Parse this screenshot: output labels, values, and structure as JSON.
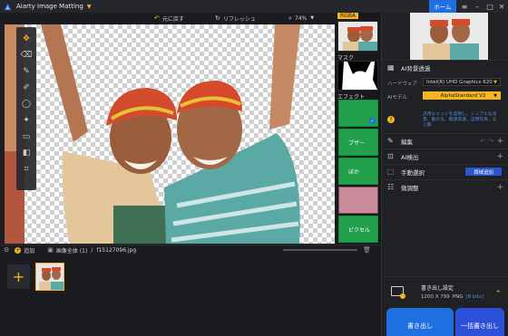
{
  "app": {
    "title": "Aiarty Image Matting",
    "home_label": "ホーム"
  },
  "toolbar": {
    "undo_label": "元に戻す",
    "refresh_label": "リフレッシュ",
    "zoom": "74%"
  },
  "strip": {
    "rgba_label": "RGBA",
    "mask_label": "マスク",
    "effect_label": "エフェクト",
    "effects": [
      {
        "name": ""
      },
      {
        "name": "ブザー"
      },
      {
        "name": "ぼか"
      },
      {
        "name": ""
      },
      {
        "name": ""
      },
      {
        "name": "ピクセル"
      }
    ]
  },
  "panel": {
    "ai_bg_title": "AI背景透過",
    "hardware_label": "ハードウェア",
    "hardware_value": "Intel(R) UHD Graphics 620",
    "model_label": "AIモデル",
    "model_value": "AlphaStandard  V2",
    "model_desc": "汎用なエッジを実現し、シンプルな背景、動の毛、無源高速、証明写真、など最",
    "edit_label": "編集",
    "ai_detect_label": "AI検出",
    "manual_select_label": "手動選択",
    "region_add_label": "領域追加",
    "fine_tune_label": "微調整",
    "export_settings_label": "書き出し設定",
    "export_size": "1200 X 799",
    "export_format": "PNG",
    "export_bits": "[8 bits]",
    "export_button": "書き出し",
    "batch_export_button": "一括書き出し"
  },
  "filebar": {
    "add_label": "追加",
    "all_images_label": "画像全体 (1)",
    "separator": "/",
    "file_name": "f15127096.jpg"
  },
  "colors": {
    "accent": "#f5b520",
    "primary": "#1f6fe0",
    "effect_green": "#23a04c"
  }
}
